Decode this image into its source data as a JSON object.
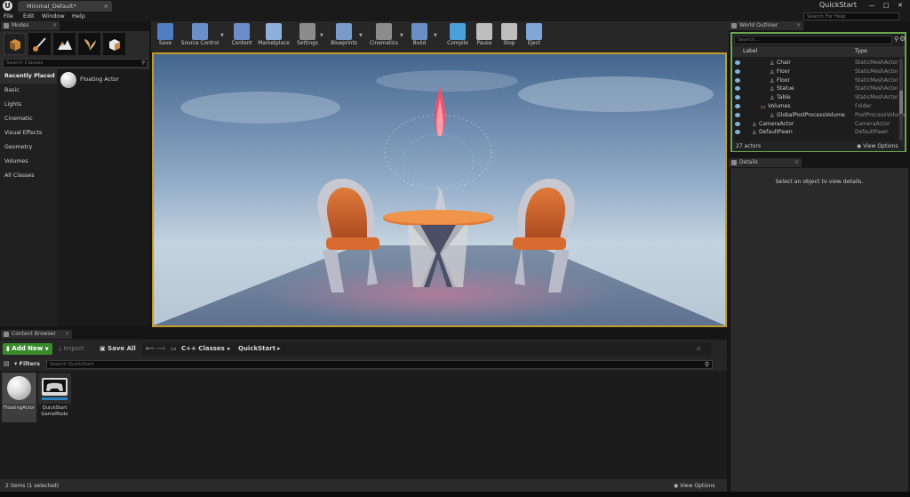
{
  "window": {
    "tab_title": "Minimal_Default*",
    "project_name": "QuickStart",
    "minimize": "—",
    "maximize": "□",
    "close": "✕",
    "tab_close": "×"
  },
  "menu": {
    "items": [
      "File",
      "Edit",
      "Window",
      "Help"
    ],
    "help_search_placeholder": "Search For Help"
  },
  "modes": {
    "tab_label": "Modes",
    "search_placeholder": "Search Classes",
    "categories": [
      "Recently Placed",
      "Basic",
      "Lights",
      "Cinematic",
      "Visual Effects",
      "Geometry",
      "Volumes",
      "All Classes"
    ],
    "placed_item": "Floating Actor"
  },
  "toolbar": {
    "buttons": [
      {
        "label": "Save",
        "color": "#4f7fc0"
      },
      {
        "label": "Source Control",
        "color": "#6a8fc6"
      },
      {
        "label": "Content",
        "color": "#6a8fc6"
      },
      {
        "label": "Marketplace",
        "color": "#8fb0d8"
      },
      {
        "label": "Settings",
        "color": "#8c8c8c"
      },
      {
        "label": "Blueprints",
        "color": "#7a9bc9"
      },
      {
        "label": "Cinematics",
        "color": "#8c8c8c"
      },
      {
        "label": "Build",
        "color": "#6a8fc6"
      },
      {
        "label": "Compile",
        "color": "#4aa0d8"
      },
      {
        "label": "Pause",
        "color": "#bdbdbd"
      },
      {
        "label": "Stop",
        "color": "#bdbdbd"
      },
      {
        "label": "Eject",
        "color": "#7fa7d6"
      }
    ]
  },
  "outliner": {
    "tab_label": "World Outliner",
    "search_placeholder": "Search...",
    "col_label": "Label",
    "col_type": "Type",
    "rows": [
      {
        "label": "Chair",
        "type": "StaticMeshActor",
        "indent": 3
      },
      {
        "label": "Floor",
        "type": "StaticMeshActor",
        "indent": 3
      },
      {
        "label": "Floor",
        "type": "StaticMeshActor",
        "indent": 3
      },
      {
        "label": "Statue",
        "type": "StaticMeshActor",
        "indent": 3
      },
      {
        "label": "Table",
        "type": "StaticMeshActor",
        "indent": 3
      },
      {
        "label": "Volumes",
        "type": "Folder",
        "indent": 2
      },
      {
        "label": "GlobalPostProcessVolume",
        "type": "PostProcessVolume",
        "indent": 3
      },
      {
        "label": "CameraActor",
        "type": "CameraActor",
        "indent": 1
      },
      {
        "label": "DefaultPawn",
        "type": "DefaultPawn",
        "indent": 1
      }
    ],
    "actor_count": "27 actors",
    "view_options": "View Options"
  },
  "details": {
    "tab_label": "Details",
    "empty_message": "Select an object to view details."
  },
  "content_browser": {
    "tab_label": "Content Browser",
    "add_new": "Add New",
    "import": "Import",
    "save_all": "Save All",
    "path": [
      "C++ Classes",
      "QuickStart"
    ],
    "filters": "Filters",
    "search_placeholder": "Search QuickStart",
    "assets": [
      {
        "name": "FloatingActor"
      },
      {
        "name": "QuickStart GameMode"
      }
    ],
    "status": "2 items (1 selected)",
    "view_options": "View Options"
  },
  "colors": {
    "accent_viewport": "#c29a2a",
    "accent_outliner": "#6aa84f",
    "add_new": "#3a8c2a"
  }
}
